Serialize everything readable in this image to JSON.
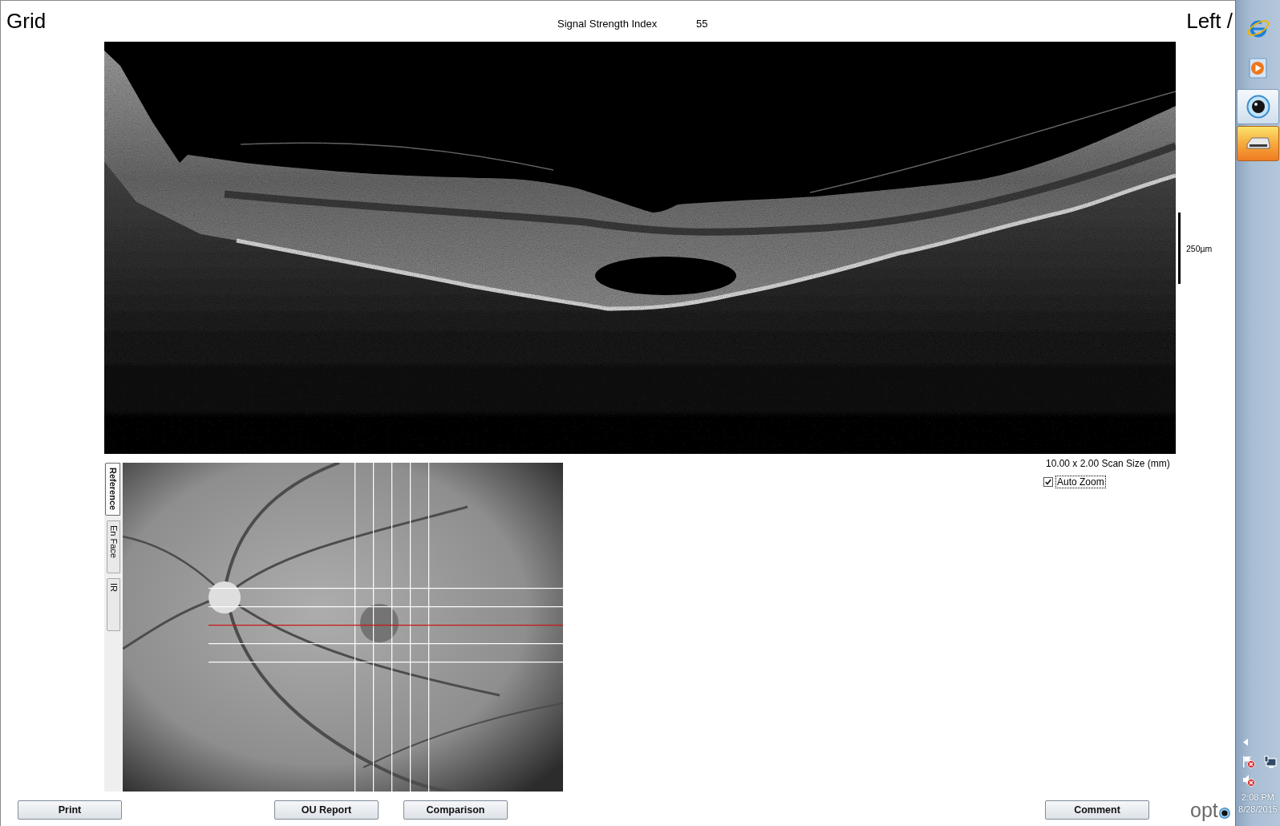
{
  "window": {
    "title": "Grid",
    "eye_label": "Left /"
  },
  "signal_strength": {
    "label": "Signal Strength Index",
    "value": "55"
  },
  "bscan": {
    "scale_label": "250µm"
  },
  "scan_info": {
    "scan_size": "10.00 x 2.00 Scan Size (mm)",
    "auto_zoom": {
      "label": "Auto Zoom",
      "checked": true,
      "focused": true
    }
  },
  "view_tabs": [
    {
      "label": "Reference",
      "selected": true
    },
    {
      "label": "En Face",
      "selected": false
    },
    {
      "label": "IR",
      "selected": false
    }
  ],
  "scan_grid": {
    "horizontal": [
      {
        "selected": false
      },
      {
        "selected": false
      },
      {
        "selected": true
      },
      {
        "selected": false
      },
      {
        "selected": false
      }
    ],
    "vertical": [
      {
        "selected": false
      },
      {
        "selected": false
      },
      {
        "selected": false
      },
      {
        "selected": false
      },
      {
        "selected": false
      }
    ]
  },
  "footer": {
    "left_buttons": [
      "Print",
      "OU Report",
      "Comparison"
    ],
    "right_buttons": [
      "Comment"
    ],
    "logo_text": "opt"
  },
  "taskbar": {
    "buttons": [
      {
        "kind": "browser",
        "active": false,
        "flashing": false
      },
      {
        "kind": "media",
        "active": false,
        "flashing": false
      },
      {
        "kind": "camera",
        "active": true,
        "flashing": false
      },
      {
        "kind": "drive",
        "active": false,
        "flashing": true
      }
    ],
    "clock": {
      "time": "2:08 PM",
      "date": "8/28/2015"
    }
  }
}
